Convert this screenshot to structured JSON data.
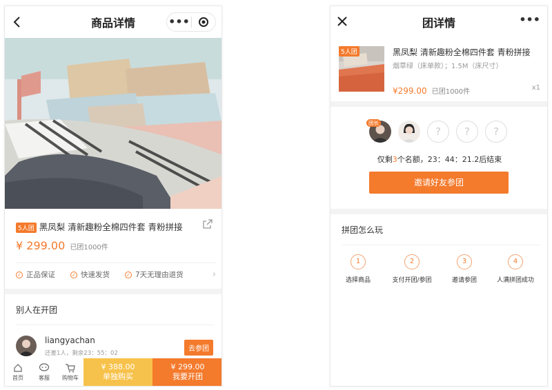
{
  "detail": {
    "title": "商品详情",
    "capsule_more": "•••",
    "product": {
      "badge": "5人团",
      "name": "黑凤梨 清新趣粉全棉四件套 青粉拼接",
      "price": "¥ 299.00",
      "sold": "已团1000件"
    },
    "guarantees": [
      "正品保证",
      "快速发货",
      "7天无理由退货"
    ],
    "others": {
      "title": "别人在开团",
      "user": "liangyachan",
      "sub": "还差1人，剩余23：55：02",
      "join": "去参团"
    },
    "tabs": [
      {
        "label": "首页",
        "icon": "home-icon"
      },
      {
        "label": "客服",
        "icon": "chat-icon"
      },
      {
        "label": "购物车",
        "icon": "cart-icon"
      }
    ],
    "buy_single": {
      "price": "¥ 388.00",
      "label": "单独购买"
    },
    "buy_group": {
      "price": "¥ 299.00",
      "label": "我要开团"
    }
  },
  "group": {
    "title": "团详情",
    "more": "•••",
    "order": {
      "badge": "5人团",
      "name": "黑凤梨 清新趣粉全棉四件套 青粉拼接",
      "spec": "烟草绿（床单款）；1.5M（床尺寸）",
      "price": "¥299.00",
      "sold": "已团1000件",
      "qty": "x1"
    },
    "leader_tag": "团长",
    "empty_slot": "?",
    "remain_prefix": "仅剩",
    "remain_num": "3",
    "remain_suffix": "个名额，23：44：21.2后结束",
    "invite": "邀请好友参团",
    "howto": {
      "title": "拼团怎么玩",
      "steps": [
        {
          "num": "1",
          "label": "选择商品"
        },
        {
          "num": "2",
          "label": "支付开团/参团"
        },
        {
          "num": "3",
          "label": "邀请参团"
        },
        {
          "num": "4",
          "label": "人满拼团成功"
        }
      ]
    }
  },
  "colors": {
    "accent": "#f47a2c",
    "single": "#f7c24b"
  }
}
